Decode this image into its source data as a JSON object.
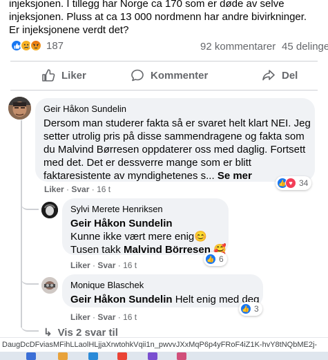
{
  "post": {
    "lines": [
      "injeksjonen. I tillegg har Norge ca 170 som er døde av selve",
      "injeksjonen. Pluss at ca 13 000 nordmenn har andre bivirkninger.",
      "Er injeksjonene verdt det?"
    ]
  },
  "stats": {
    "reactions_count": "187",
    "comments": "92 kommentarer",
    "shares": "45 delinge"
  },
  "actions": {
    "like": "Liker",
    "comment": "Kommenter",
    "share": "Del"
  },
  "comments": [
    {
      "author": "Geir Håkon Sundelin",
      "lines": [
        "Dersom man studerer fakta så er svaret helt klart NEI. Jeg",
        "setter utrolig pris på disse sammendragene og fakta som",
        "du Malvind Børresen oppdaterer oss med daglig. Fortsett",
        "med det. Det er dessverre mange som er blitt"
      ],
      "last_line": "faktaresistente av myndighetenes s...",
      "see_more": "Se mer",
      "like": "Liker",
      "reply": "Svar",
      "time": "16 t",
      "reactions": "34"
    }
  ],
  "replies": [
    {
      "author": "Sylvi Merete Henriksen",
      "mention": "Geir Håkon Sundelin",
      "line1": "Kunne ikke vært mere enig😊",
      "line2_text": "Tusen takk ",
      "line2_mention": "Malvind Börresen",
      "line2_emoji": "🥰",
      "like": "Liker",
      "reply": "Svar",
      "time": "16 t",
      "reactions": "6"
    },
    {
      "author": "Monique Blaschek",
      "mention": "Geir Håkon Sundelin",
      "text": " Helt enig med deg",
      "like": "Liker",
      "reply": "Svar",
      "time": "16 t",
      "reactions": "3"
    }
  ],
  "more_replies": "Vis 2 svar til",
  "url_bar": "DaugDcDFviasMFihLLaolHLjjaXrwtohkVqii1n_pwvvJXxMqP6p4yFRoF4iZ1K-hvY8tNQbME2j-",
  "colors": {
    "like_blue": "#1877f2",
    "love_red": "#f33e58",
    "muted": "#65676b",
    "bubble": "#f0f2f5"
  },
  "icons": {
    "like": "thumbs-up-icon",
    "comment": "speech-bubble-icon",
    "share": "share-arrow-icon",
    "more_replies": "reply-arrow-icon"
  }
}
